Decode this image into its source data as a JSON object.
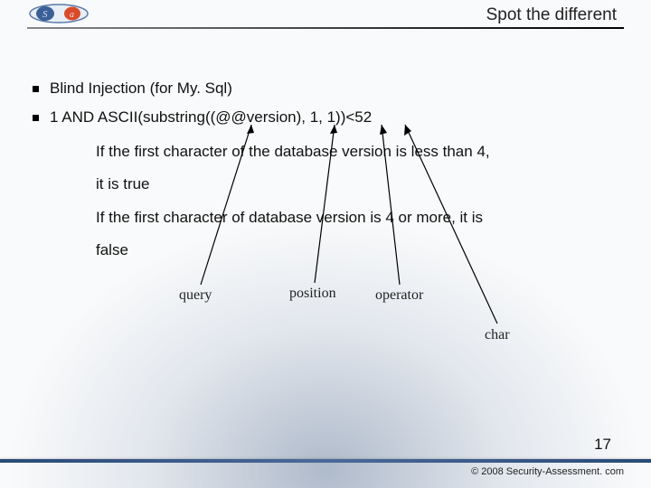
{
  "title": "Spot the different",
  "bullets": [
    "Blind Injection (for My. Sql)",
    "1 AND ASCII(substring((@@version), 1, 1))<52"
  ],
  "explain": {
    "p1": "If the first character of the database version is less than 4,",
    "p2": "it is true",
    "p3": "If the first character of database version is 4 or more, it is",
    "p4": "false"
  },
  "labels": {
    "query": "query",
    "position": "position",
    "operator": "operator",
    "char": "char"
  },
  "pagenum": "17",
  "copyright": "© 2008 Security-Assessment. com"
}
